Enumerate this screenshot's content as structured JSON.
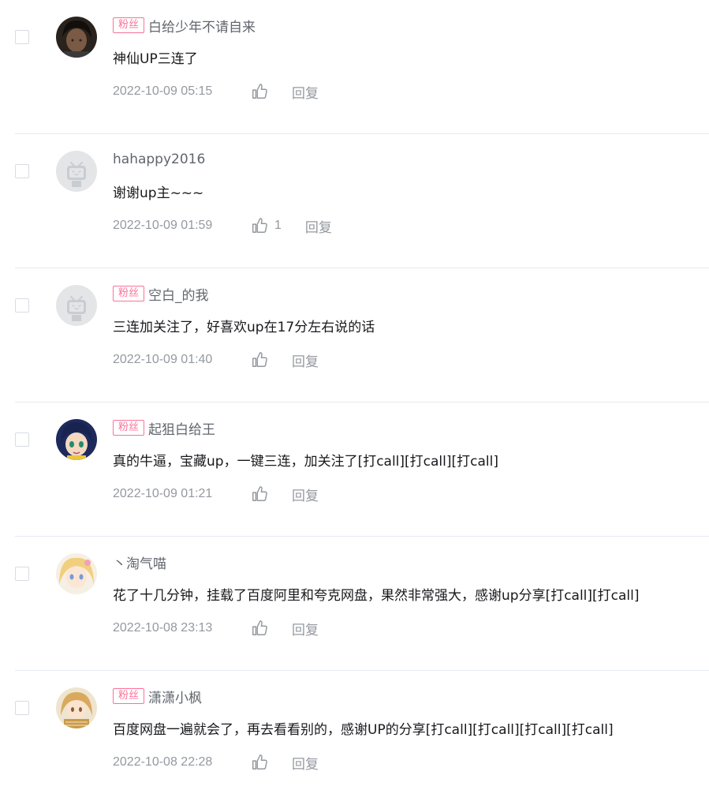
{
  "comments": [
    {
      "badge": "粉丝",
      "username": "白给少年不请自来",
      "text": "神仙UP三连了",
      "time": "2022-10-09 05:15",
      "likes": "",
      "reply": "回复",
      "avatar": "dark-hair-avatar"
    },
    {
      "badge": "",
      "username": "hahappy2016",
      "text": "谢谢up主~~~",
      "time": "2022-10-09 01:59",
      "likes": "1",
      "reply": "回复",
      "avatar": "default-tv-avatar"
    },
    {
      "badge": "粉丝",
      "username": "空白_的我",
      "text": "三连加关注了，好喜欢up在17分左右说的话",
      "time": "2022-10-09 01:40",
      "likes": "",
      "reply": "回复",
      "avatar": "default-tv-avatar"
    },
    {
      "badge": "粉丝",
      "username": "起狙白给王",
      "text": "真的牛逼，宝藏up，一键三连，加关注了[打call][打call][打call]",
      "time": "2022-10-09 01:21",
      "likes": "",
      "reply": "回复",
      "avatar": "anime-girl-avatar"
    },
    {
      "badge": "",
      "username": "丶淘气喵",
      "text": "花了十几分钟，挂载了百度阿里和夸克网盘，果然非常强大，感谢up分享[打call][打call]",
      "time": "2022-10-08 23:13",
      "likes": "",
      "reply": "回复",
      "avatar": "blonde-anime-avatar"
    },
    {
      "badge": "粉丝",
      "username": "潇潇小枫",
      "text": "百度网盘一遍就会了，再去看看别的，感谢UP的分享[打call][打call][打call][打call]",
      "time": "2022-10-08 22:28",
      "likes": "",
      "reply": "回复",
      "avatar": "golden-anime-avatar"
    }
  ],
  "colors": {
    "badge": "#fb7299",
    "muted": "#9499a0",
    "divider": "#e5e9ef"
  }
}
